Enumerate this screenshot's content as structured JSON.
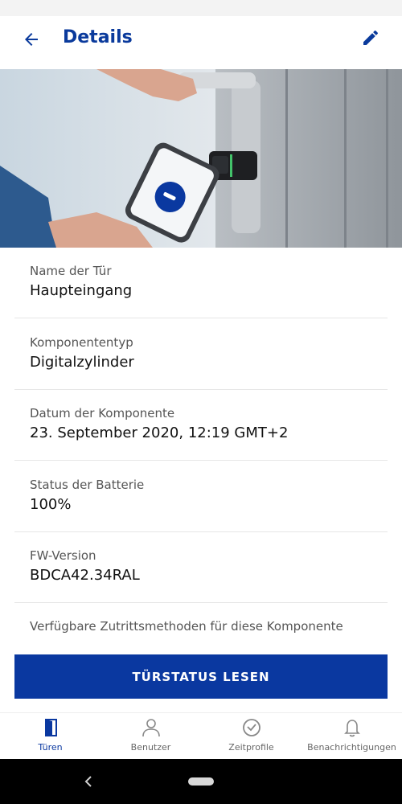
{
  "header": {
    "title": "Details",
    "back_icon": "arrow-left-icon",
    "edit_icon": "pencil-icon",
    "accent": "#0a3a9c"
  },
  "fields": [
    {
      "label": "Name der Tür",
      "value": "Haupteingang"
    },
    {
      "label": "Komponententyp",
      "value": "Digitalzylinder"
    },
    {
      "label": "Datum der Komponente",
      "value": "23. September 2020, 12:19 GMT+2"
    },
    {
      "label": "Status der Batterie",
      "value": "100%"
    },
    {
      "label": "FW-Version",
      "value": "BDCA42.34RAL"
    }
  ],
  "access_methods_label": "Verfügbare Zutrittsmethoden für diese Komponente",
  "primary_button": {
    "label": "TÜRSTATUS LESEN",
    "color": "#0a38a0"
  },
  "bottom_nav": [
    {
      "label": "Türen",
      "icon": "door-icon",
      "active": true
    },
    {
      "label": "Benutzer",
      "icon": "user-icon",
      "active": false
    },
    {
      "label": "Zeitprofile",
      "icon": "clock-icon",
      "active": false
    },
    {
      "label": "Benachrichtigungen",
      "icon": "bell-icon",
      "active": false
    }
  ]
}
